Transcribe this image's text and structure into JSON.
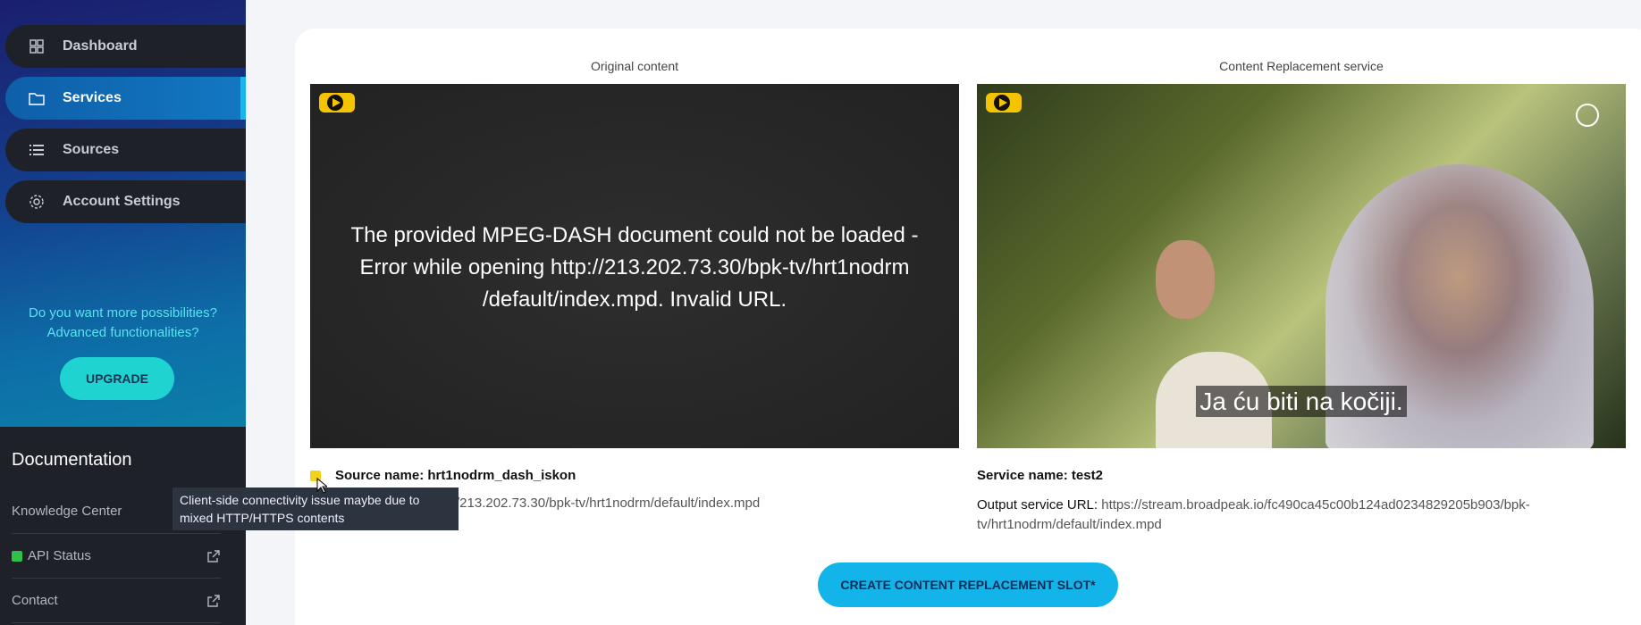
{
  "sidebar": {
    "items": [
      {
        "label": "Dashboard",
        "icon": "grid-icon"
      },
      {
        "label": "Services",
        "icon": "folder-icon"
      },
      {
        "label": "Sources",
        "icon": "list-icon"
      },
      {
        "label": "Account Settings",
        "icon": "gear-icon"
      }
    ],
    "promo_line1": "Do you want more possibilities?",
    "promo_line2": "Advanced functionalities?",
    "upgrade_label": "UPGRADE",
    "documentation": {
      "title": "Documentation",
      "links": [
        {
          "label": "Knowledge Center"
        },
        {
          "label": "API Status"
        },
        {
          "label": "Contact"
        }
      ]
    }
  },
  "main": {
    "original_label": "Original content",
    "replacement_label": "Content Replacement service",
    "error_message": "The provided MPEG-DASH document could not be loaded - Error while opening http://213.202.73.30/bpk-tv/hrt1nodrm /default/index.mpd. Invalid URL.",
    "subtitle_text": "Ja ću biti na kočiji.",
    "source_name_label": "Source name:",
    "source_name_value": "hrt1nodrm_dash_iskon",
    "source_url_partial": "/213.202.73.30/bpk-tv/hrt1nodrm/default/index.mpd",
    "tooltip_text": "Client-side connectivity issue maybe due to mixed HTTP/HTTPS contents",
    "service_name_label": "Service name:",
    "service_name_value": "test2",
    "output_url_label": "Output service URL:",
    "output_url_value": "https://stream.broadpeak.io/fc490ca45c00b124ad0234829205b903/bpk-tv/hrt1nodrm/default/index.mpd",
    "cta_label": "CREATE CONTENT REPLACEMENT SLOT*"
  },
  "colors": {
    "accent": "#13b4e9",
    "upgrade": "#1fd3d0",
    "status_ok": "#2fc24a",
    "warning": "#f2d21a"
  }
}
